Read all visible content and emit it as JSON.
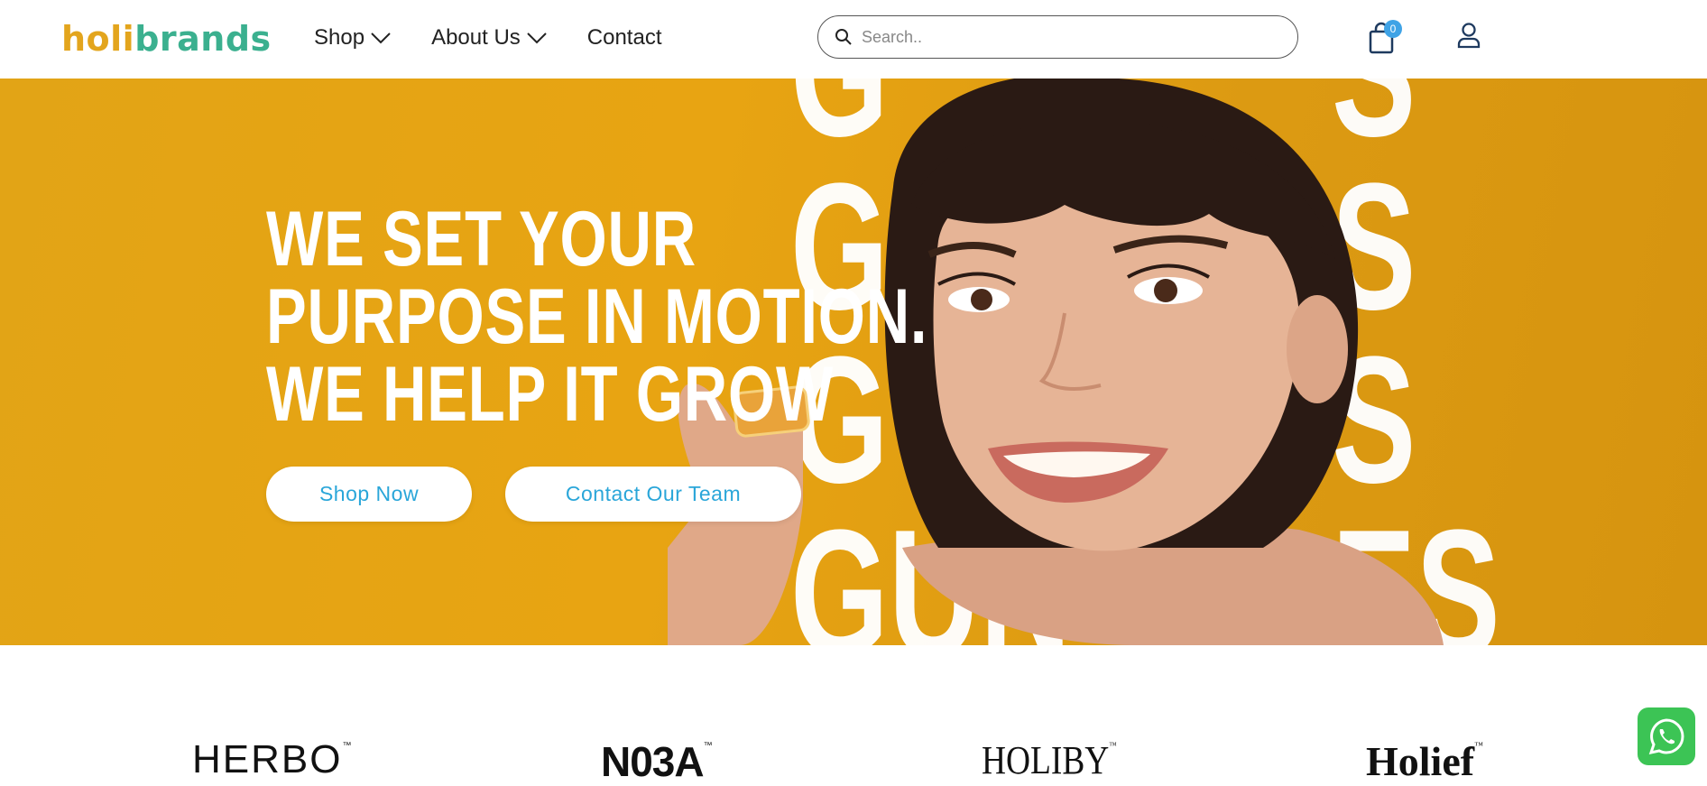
{
  "header": {
    "logo": {
      "part1": "holi",
      "part2": "brands"
    },
    "nav": [
      {
        "label": "Shop",
        "has_dropdown": true
      },
      {
        "label": "About Us",
        "has_dropdown": true
      },
      {
        "label": "Contact",
        "has_dropdown": false
      }
    ],
    "search": {
      "placeholder": "Search..",
      "value": "",
      "icon": "search-icon"
    },
    "cart": {
      "count": "0",
      "icon": "shopping-bag-icon"
    },
    "account": {
      "icon": "user-icon"
    }
  },
  "hero": {
    "headline": [
      "WE SET YOUR",
      "PURPOSE IN MOTION.",
      "WE HELP IT GROW"
    ],
    "background_letters": [
      "G",
      "S",
      "G",
      "S",
      "G",
      "S",
      "GUN",
      "ES"
    ],
    "buttons": {
      "shop_now": "Shop Now",
      "contact_team": "Contact Our Team"
    },
    "colors": {
      "background": "#e2a416",
      "button_text": "#2aa6d9"
    }
  },
  "brands": [
    {
      "name": "HERBO",
      "trademark": "™"
    },
    {
      "name": "N03A",
      "trademark": "™"
    },
    {
      "name": "HOLIBY",
      "trademark": "™"
    },
    {
      "name": "Holief",
      "trademark": "™"
    }
  ],
  "colors": {
    "logo_orange": "#e3a51d",
    "logo_green": "#3bb08f",
    "cart_badge": "#3fa3e6",
    "whatsapp": "#3cc455"
  }
}
